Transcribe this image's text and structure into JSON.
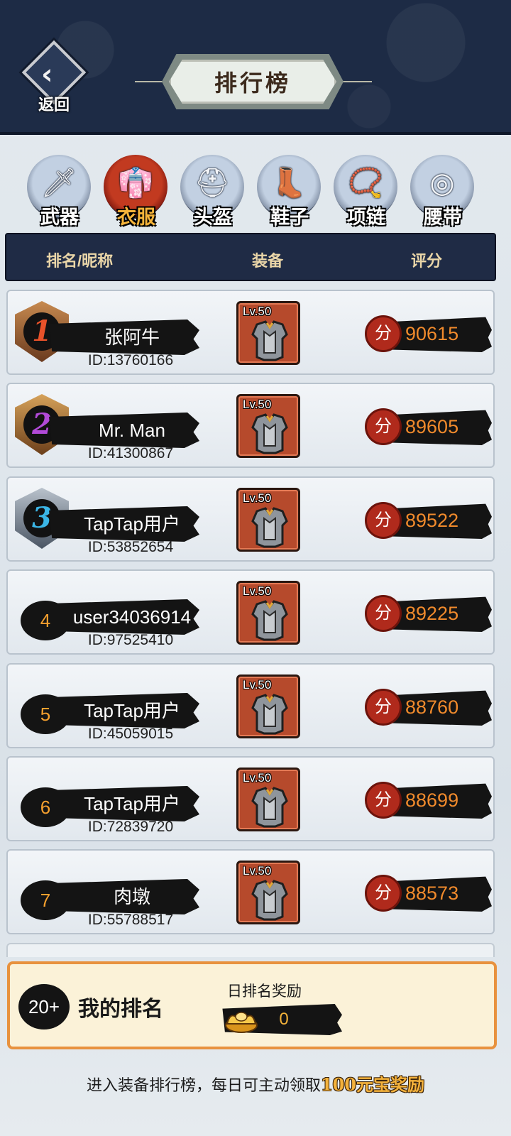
{
  "header": {
    "back_label": "返回",
    "title": "排行榜"
  },
  "tabs": [
    {
      "label": "武器",
      "icon": "sword-icon",
      "glyph": "🗡",
      "active": false
    },
    {
      "label": "衣服",
      "icon": "clothing-icon",
      "glyph": "👘",
      "active": true
    },
    {
      "label": "头盔",
      "icon": "helmet-icon",
      "glyph": "⛑",
      "active": false
    },
    {
      "label": "鞋子",
      "icon": "boot-icon",
      "glyph": "👢",
      "active": false
    },
    {
      "label": "项链",
      "icon": "necklace-icon",
      "glyph": "📿",
      "active": false
    },
    {
      "label": "腰带",
      "icon": "belt-icon",
      "glyph": "◎",
      "active": false
    }
  ],
  "columns": {
    "rank_name": "排名/昵称",
    "equipment": "装备",
    "score": "评分"
  },
  "score_chip_label": "分",
  "rows": [
    {
      "rank": "1",
      "name": "张阿牛",
      "id": "ID:13760166",
      "level": "Lv.50",
      "score": "90615"
    },
    {
      "rank": "2",
      "name": "Mr.  Man",
      "id": "ID:41300867",
      "level": "Lv.50",
      "score": "89605"
    },
    {
      "rank": "3",
      "name": "TapTap用户",
      "id": "ID:53852654",
      "level": "Lv.50",
      "score": "89522"
    },
    {
      "rank": "4",
      "name": "user34036914",
      "id": "ID:97525410",
      "level": "Lv.50",
      "score": "89225"
    },
    {
      "rank": "5",
      "name": "TapTap用户",
      "id": "ID:45059015",
      "level": "Lv.50",
      "score": "88760"
    },
    {
      "rank": "6",
      "name": "TapTap用户",
      "id": "ID:72839720",
      "level": "Lv.50",
      "score": "88699"
    },
    {
      "rank": "7",
      "name": "肉墩",
      "id": "ID:55788517",
      "level": "Lv.50",
      "score": "88573"
    }
  ],
  "my_rank": {
    "rank": "20+",
    "label": "我的排名",
    "reward_label": "日排名奖励",
    "reward_icon": "gold-ingot-icon",
    "reward_value": "0"
  },
  "footer": {
    "text": "进入装备排行榜，每日可主动领取",
    "highlight": "100元宝奖励"
  },
  "colors": {
    "header_bg": "#1d2b45",
    "active_tab": "#c23a20",
    "score_text": "#f08a2c",
    "equip_bg": "#b64a2c",
    "my_rank_border": "#e8923e",
    "medal_1": "#e8522a",
    "medal_2": "#b24ad8",
    "medal_3": "#3bb6e6"
  }
}
